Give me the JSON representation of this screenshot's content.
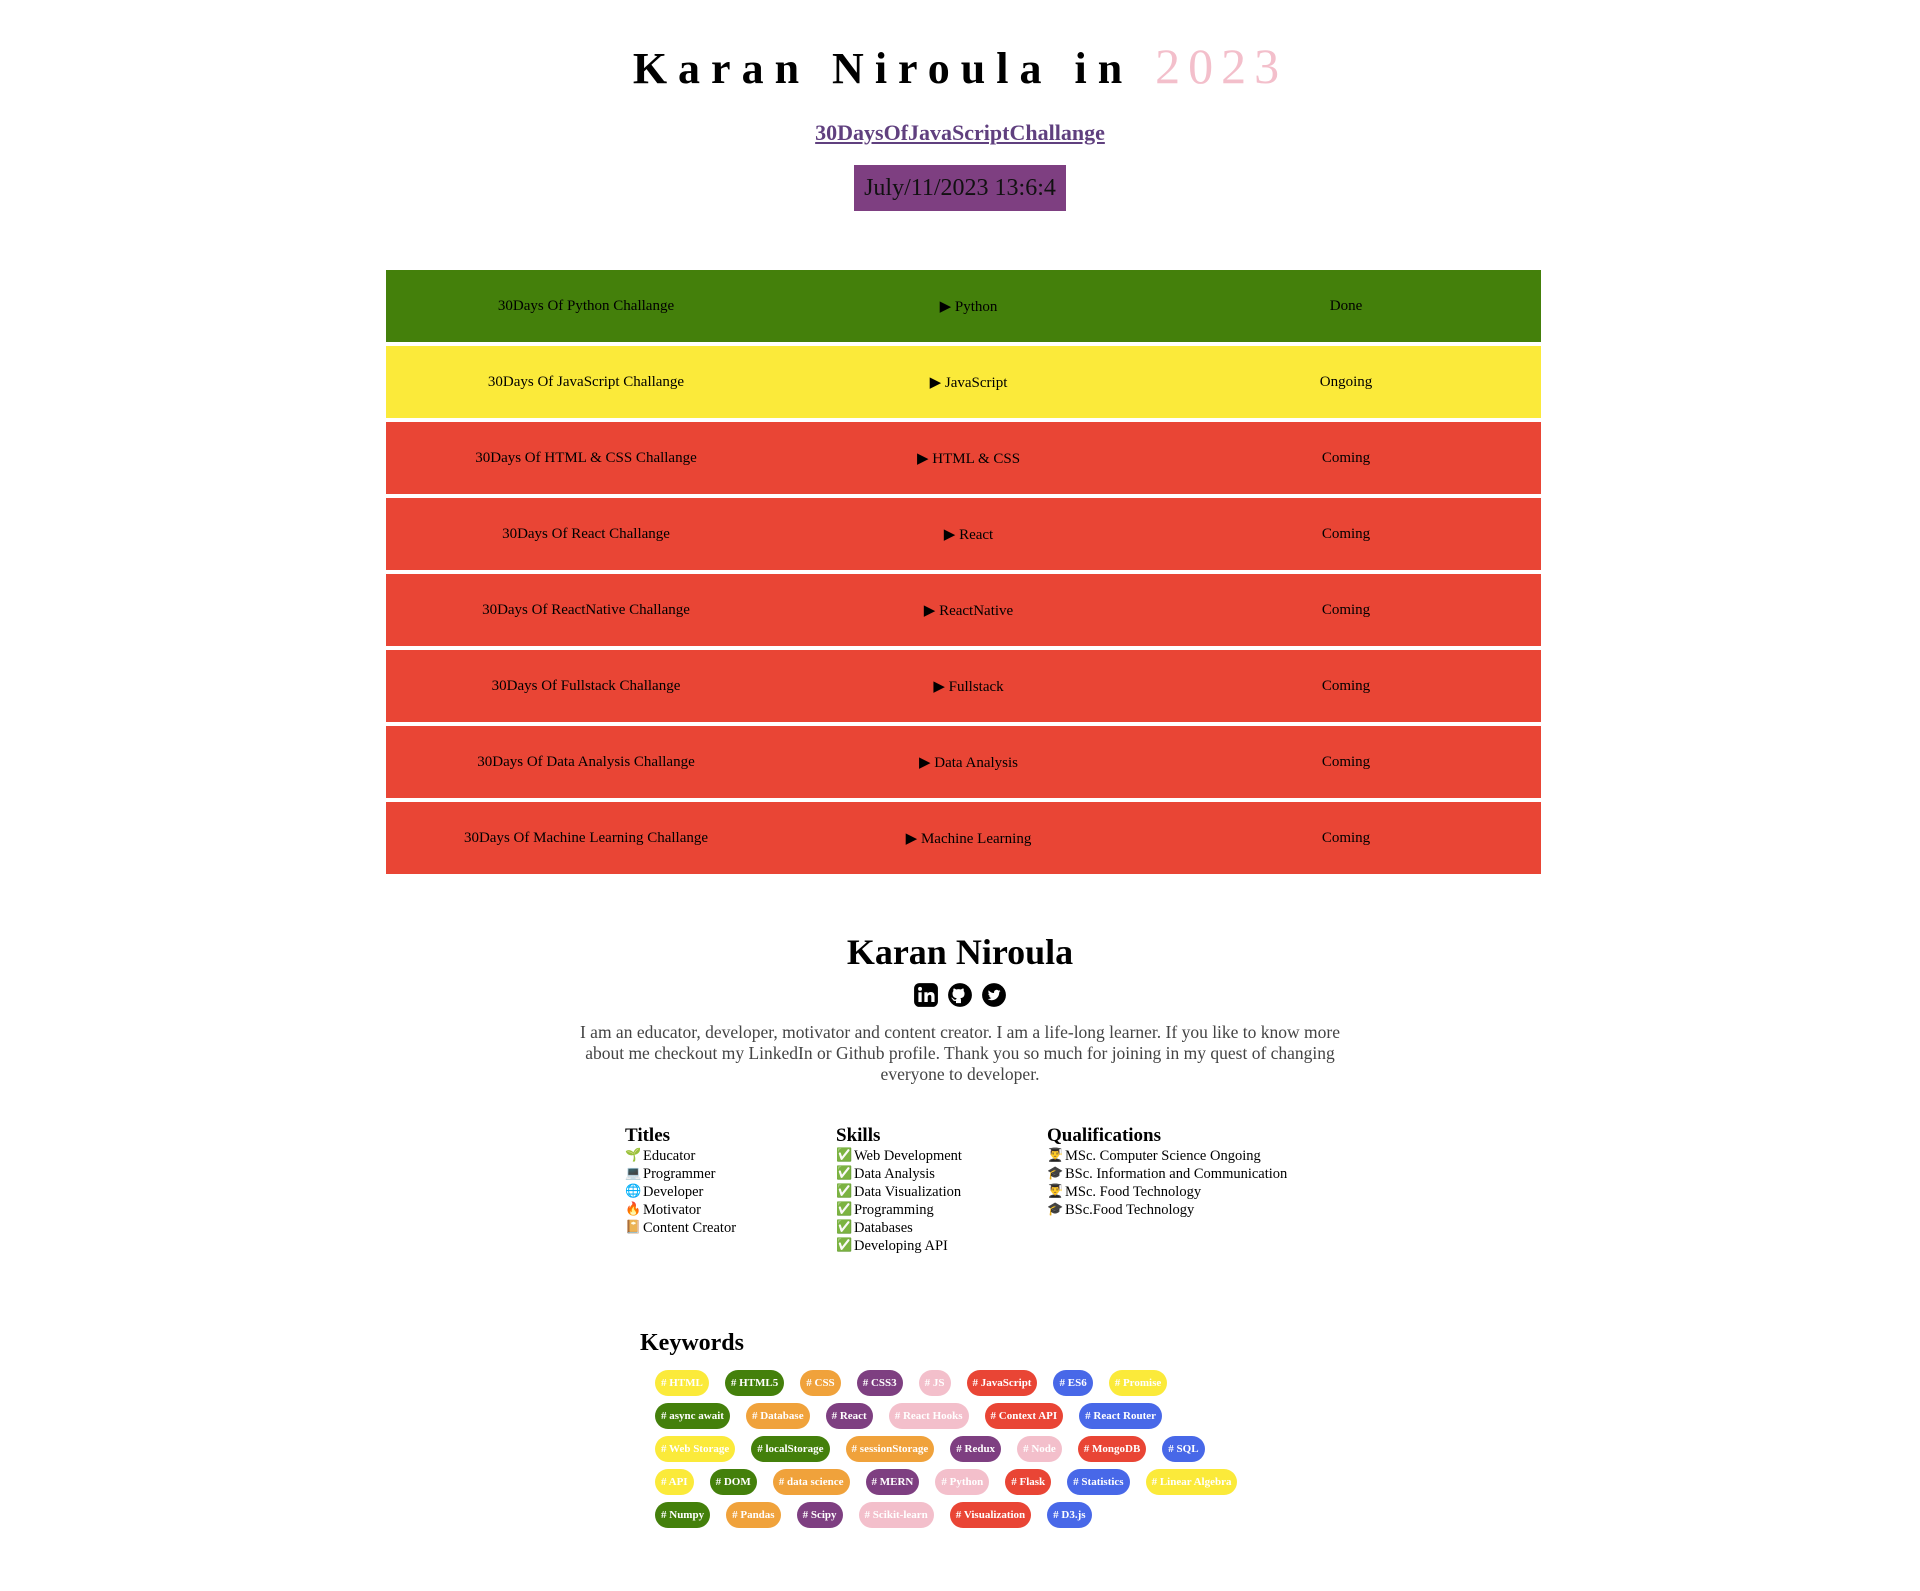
{
  "header": {
    "title_name": "Karan Niroula in",
    "title_year": "2023",
    "link_text": "30DaysOfJavaScriptChallange",
    "datetime": "July/11/2023 13:6:4"
  },
  "challenges": [
    {
      "name": "30Days Of Python Challange",
      "topic": "Python",
      "status": "Done",
      "color": "#44800b"
    },
    {
      "name": "30Days Of JavaScript Challange",
      "topic": "JavaScript",
      "status": "Ongoing",
      "color": "#fbea3a"
    },
    {
      "name": "30Days Of HTML & CSS Challange",
      "topic": "HTML & CSS",
      "status": "Coming",
      "color": "#e94535"
    },
    {
      "name": "30Days Of React Challange",
      "topic": "React",
      "status": "Coming",
      "color": "#e94535"
    },
    {
      "name": "30Days Of ReactNative Challange",
      "topic": "ReactNative",
      "status": "Coming",
      "color": "#e94535"
    },
    {
      "name": "30Days Of Fullstack Challange",
      "topic": "Fullstack",
      "status": "Coming",
      "color": "#e94535"
    },
    {
      "name": "30Days Of Data Analysis Challange",
      "topic": "Data Analysis",
      "status": "Coming",
      "color": "#e94535"
    },
    {
      "name": "30Days Of Machine Learning Challange",
      "topic": "Machine Learning",
      "status": "Coming",
      "color": "#e94535"
    }
  ],
  "topic_marker": "▶",
  "profile": {
    "name": "Karan Niroula",
    "socials": [
      "linkedin-icon",
      "github-icon",
      "twitter-icon"
    ],
    "bio": "I am an educator, developer, motivator and content creator. I am a life-long learner. If you like to know more about me checkout my LinkedIn or Github profile. Thank you so much for joining in my quest of changing everyone to developer."
  },
  "titles": {
    "heading": "Titles",
    "items": [
      {
        "emoji": "🌱",
        "text": "Educator"
      },
      {
        "emoji": "💻",
        "text": "Programmer"
      },
      {
        "emoji": "🌐",
        "text": "Developer"
      },
      {
        "emoji": "🔥",
        "text": "Motivator"
      },
      {
        "emoji": "📔",
        "text": "Content Creator"
      }
    ]
  },
  "skills": {
    "heading": "Skills",
    "items": [
      {
        "emoji": "✅",
        "text": "Web Development"
      },
      {
        "emoji": "✅",
        "text": "Data Analysis"
      },
      {
        "emoji": "✅",
        "text": "Data Visualization"
      },
      {
        "emoji": "✅",
        "text": "Programming"
      },
      {
        "emoji": "✅",
        "text": "Databases"
      },
      {
        "emoji": "✅",
        "text": "Developing API"
      }
    ]
  },
  "qualifications": {
    "heading": "Qualifications",
    "items": [
      {
        "emoji": "👨‍🎓",
        "text": "MSc. Computer Science Ongoing"
      },
      {
        "emoji": "🎓",
        "text": "BSc. Information and Communication"
      },
      {
        "emoji": "👨‍🎓",
        "text": "MSc. Food Technology"
      },
      {
        "emoji": "🎓",
        "text": "BSc.Food Technology"
      }
    ]
  },
  "keywords": {
    "heading": "Keywords",
    "lines": [
      [
        {
          "text": "# HTML",
          "color": "#fbea3a"
        },
        {
          "text": "# HTML5",
          "color": "#44800b"
        },
        {
          "text": "# CSS",
          "color": "#f0a23b"
        },
        {
          "text": "# CSS3",
          "color": "#7e3f81"
        },
        {
          "text": "# JS",
          "color": "#f3bfcb"
        },
        {
          "text": "# JavaScript",
          "color": "#e94535"
        },
        {
          "text": "# ES6",
          "color": "#4868e8"
        },
        {
          "text": "# Promise",
          "color": "#fbea3a"
        }
      ],
      [
        {
          "text": "# async await",
          "color": "#44800b"
        },
        {
          "text": "# Database",
          "color": "#f0a23b"
        },
        {
          "text": "# React",
          "color": "#7e3f81"
        },
        {
          "text": "# React Hooks",
          "color": "#f3bfcb"
        },
        {
          "text": "# Context API",
          "color": "#e94535"
        },
        {
          "text": "# React Router",
          "color": "#4868e8"
        }
      ],
      [
        {
          "text": "# Web Storage",
          "color": "#fbea3a"
        },
        {
          "text": "# localStorage",
          "color": "#44800b"
        },
        {
          "text": "# sessionStorage",
          "color": "#f0a23b"
        },
        {
          "text": "# Redux",
          "color": "#7e3f81"
        },
        {
          "text": "# Node",
          "color": "#f3bfcb"
        },
        {
          "text": "# MongoDB",
          "color": "#e94535"
        },
        {
          "text": "# SQL",
          "color": "#4868e8"
        }
      ],
      [
        {
          "text": "# API",
          "color": "#fbea3a"
        },
        {
          "text": "# DOM",
          "color": "#44800b"
        },
        {
          "text": "# data science",
          "color": "#f0a23b"
        },
        {
          "text": "# MERN",
          "color": "#7e3f81"
        },
        {
          "text": "# Python",
          "color": "#f3bfcb"
        },
        {
          "text": "# Flask",
          "color": "#e94535"
        },
        {
          "text": "# Statistics",
          "color": "#4868e8"
        },
        {
          "text": "# Linear Algebra",
          "color": "#fbea3a"
        }
      ],
      [
        {
          "text": "# Numpy",
          "color": "#44800b"
        },
        {
          "text": "# Pandas",
          "color": "#f0a23b"
        },
        {
          "text": "# Scipy",
          "color": "#7e3f81"
        },
        {
          "text": "# Scikit-learn",
          "color": "#f3bfcb"
        },
        {
          "text": "# Visualization",
          "color": "#e94535"
        },
        {
          "text": "# D3.js",
          "color": "#4868e8"
        }
      ]
    ]
  }
}
